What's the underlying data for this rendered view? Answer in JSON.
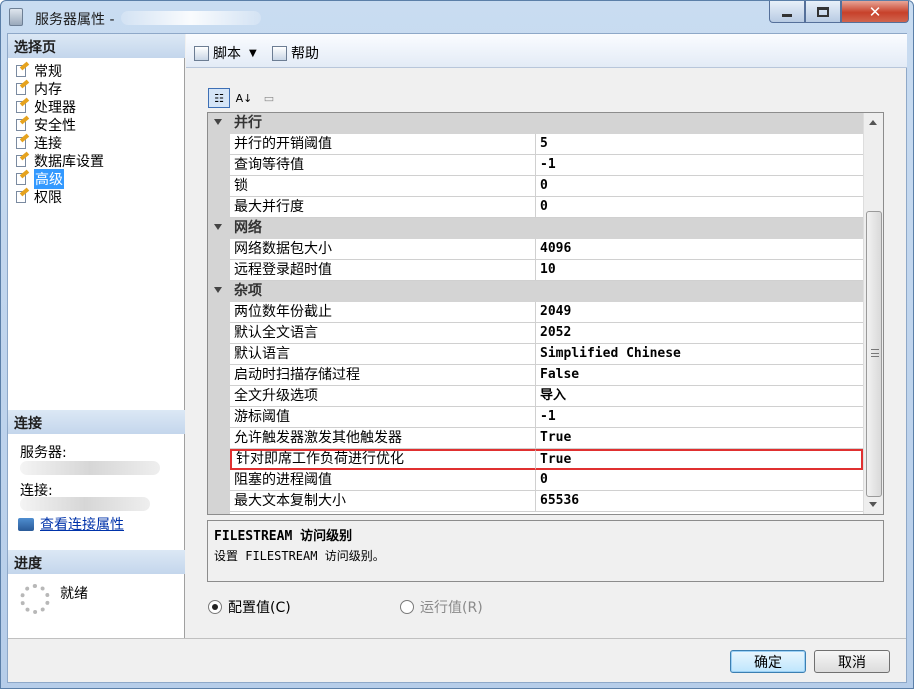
{
  "window": {
    "title": "服务器属性 -"
  },
  "left": {
    "select_page_header": "选择页",
    "pages": [
      {
        "label": "常规"
      },
      {
        "label": "内存"
      },
      {
        "label": "处理器"
      },
      {
        "label": "安全性"
      },
      {
        "label": "连接"
      },
      {
        "label": "数据库设置"
      },
      {
        "label": "高级",
        "selected": true
      },
      {
        "label": "权限"
      }
    ],
    "connection_header": "连接",
    "server_label": "服务器:",
    "connection_label": "连接:",
    "view_connection_link": "查看连接属性",
    "progress_header": "进度",
    "progress_status": "就绪"
  },
  "toolbar": {
    "script_label": "脚本",
    "help_label": "帮助"
  },
  "grid": {
    "categories": [
      {
        "name": "并行",
        "rows": [
          {
            "name": "并行的开销阈值",
            "value": "5"
          },
          {
            "name": "查询等待值",
            "value": "-1"
          },
          {
            "name": "锁",
            "value": "0"
          },
          {
            "name": "最大并行度",
            "value": "0"
          }
        ]
      },
      {
        "name": "网络",
        "rows": [
          {
            "name": "网络数据包大小",
            "value": "4096"
          },
          {
            "name": "远程登录超时值",
            "value": "10"
          }
        ]
      },
      {
        "name": "杂项",
        "rows": [
          {
            "name": "两位数年份截止",
            "value": "2049"
          },
          {
            "name": "默认全文语言",
            "value": "2052"
          },
          {
            "name": "默认语言",
            "value": "Simplified Chinese"
          },
          {
            "name": "启动时扫描存储过程",
            "value": "False"
          },
          {
            "name": "全文升级选项",
            "value": "导入"
          },
          {
            "name": "游标阈值",
            "value": "-1"
          },
          {
            "name": "允许触发器激发其他触发器",
            "value": "True"
          },
          {
            "name": "针对即席工作负荷进行优化",
            "value": "True",
            "highlighted": true
          },
          {
            "name": "阻塞的进程阈值",
            "value": "0"
          },
          {
            "name": "最大文本复制大小",
            "value": "65536"
          }
        ]
      }
    ]
  },
  "description": {
    "title": "FILESTREAM 访问级别",
    "body": "设置 FILESTREAM 访问级别。"
  },
  "radios": {
    "configured_label": "配置值(C)",
    "running_label": "运行值(R)"
  },
  "buttons": {
    "ok": "确定",
    "cancel": "取消"
  },
  "colors": {
    "selection": "#3399ff",
    "highlight_border": "#e03030"
  }
}
